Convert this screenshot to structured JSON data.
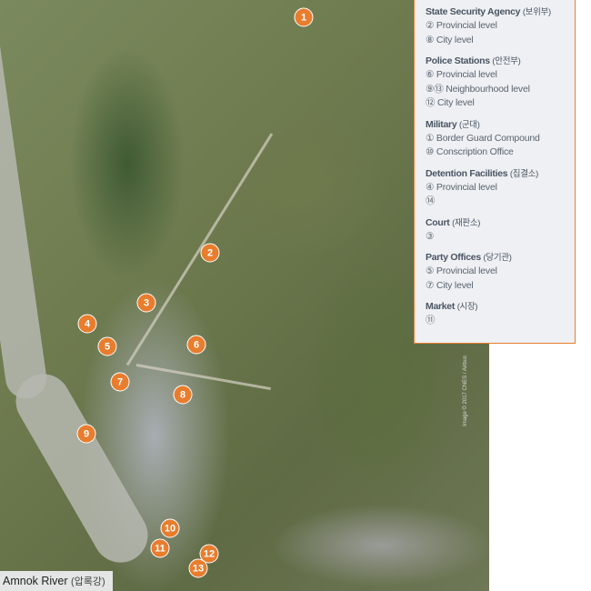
{
  "legend": {
    "sections": [
      {
        "title": "State Security Agency",
        "korean": "(보위부)",
        "items": [
          "② Provincial level",
          "⑧ City level"
        ]
      },
      {
        "title": "Police Stations",
        "korean": "(안전부)",
        "items": [
          "⑥ Provincial level",
          "⑨⑬ Neighbourhood level",
          "⑫ City level"
        ]
      },
      {
        "title": "Military",
        "korean": "(군대)",
        "items": [
          "① Border Guard Compound",
          "⑩ Conscription Office"
        ]
      },
      {
        "title": "Detention Facilities",
        "korean": "(집결소)",
        "items": [
          "④ Provincial level",
          "⑭"
        ]
      },
      {
        "title": "Court",
        "korean": "(재판소)",
        "items": [
          "③"
        ]
      },
      {
        "title": "Party Offices",
        "korean": "(당기관)",
        "items": [
          "⑤ Provincial level",
          "⑦ City level"
        ]
      },
      {
        "title": "Market",
        "korean": "(시장)",
        "items": [
          "⑪"
        ]
      }
    ]
  },
  "markers": [
    "1",
    "2",
    "3",
    "4",
    "5",
    "6",
    "7",
    "8",
    "9",
    "10",
    "11",
    "12",
    "13"
  ],
  "river_label": {
    "name": "Amnok River",
    "korean": "(압록강)"
  },
  "credit": "Image © 2017 CNES / Airbus",
  "colors": {
    "marker": "#e87d2e",
    "legend_border": "#e87d2e",
    "legend_bg": "#eef0f3"
  }
}
